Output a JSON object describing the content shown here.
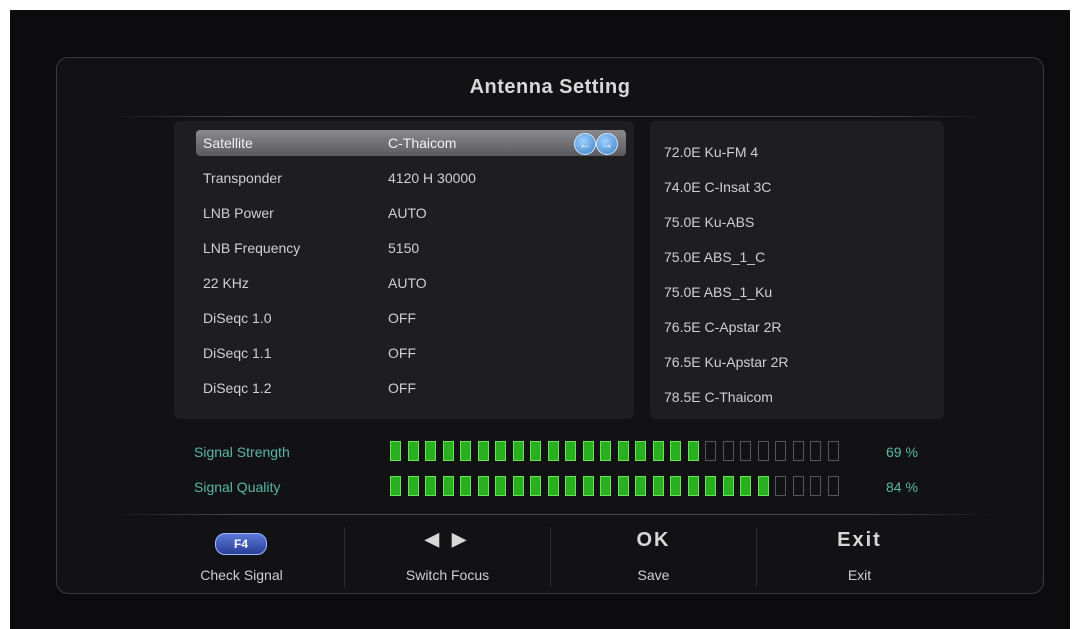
{
  "title": "Antenna Setting",
  "settings": [
    {
      "label": "Satellite",
      "value": "C-Thaicom",
      "selected": true
    },
    {
      "label": "Transponder",
      "value": "4120 H 30000"
    },
    {
      "label": "LNB Power",
      "value": "AUTO"
    },
    {
      "label": "LNB Frequency",
      "value": "5150"
    },
    {
      "label": "22 KHz",
      "value": "AUTO"
    },
    {
      "label": "DiSeqc 1.0",
      "value": "OFF"
    },
    {
      "label": "DiSeqc 1.1",
      "value": "OFF"
    },
    {
      "label": "DiSeqc 1.2",
      "value": "OFF"
    }
  ],
  "nav_icons": {
    "left": "arrow-left-icon",
    "right": "arrow-right-icon",
    "left_glyph": "←",
    "right_glyph": "→"
  },
  "satellites": [
    "72.0E Ku-FM 4",
    "74.0E C-Insat 3C",
    "75.0E Ku-ABS",
    "75.0E ABS_1_C",
    "75.0E ABS_1_Ku",
    "76.5E C-Apstar 2R",
    "76.5E Ku-Apstar 2R",
    "78.5E C-Thaicom"
  ],
  "signal": {
    "strength": {
      "label": "Signal Strength",
      "value_text": "69 %",
      "fraction": 0.69
    },
    "quality": {
      "label": "Signal Quality",
      "value_text": "84 %",
      "fraction": 0.84
    },
    "total_segments": 26,
    "on_color": "#28b020",
    "text_color": "#5ab6a8"
  },
  "footer": [
    {
      "key": "F4",
      "caption": "Check Signal"
    },
    {
      "key": "◀ ▶",
      "caption": "Switch Focus"
    },
    {
      "key": "OK",
      "caption": "Save"
    },
    {
      "key": "Exit",
      "caption": "Exit"
    }
  ]
}
